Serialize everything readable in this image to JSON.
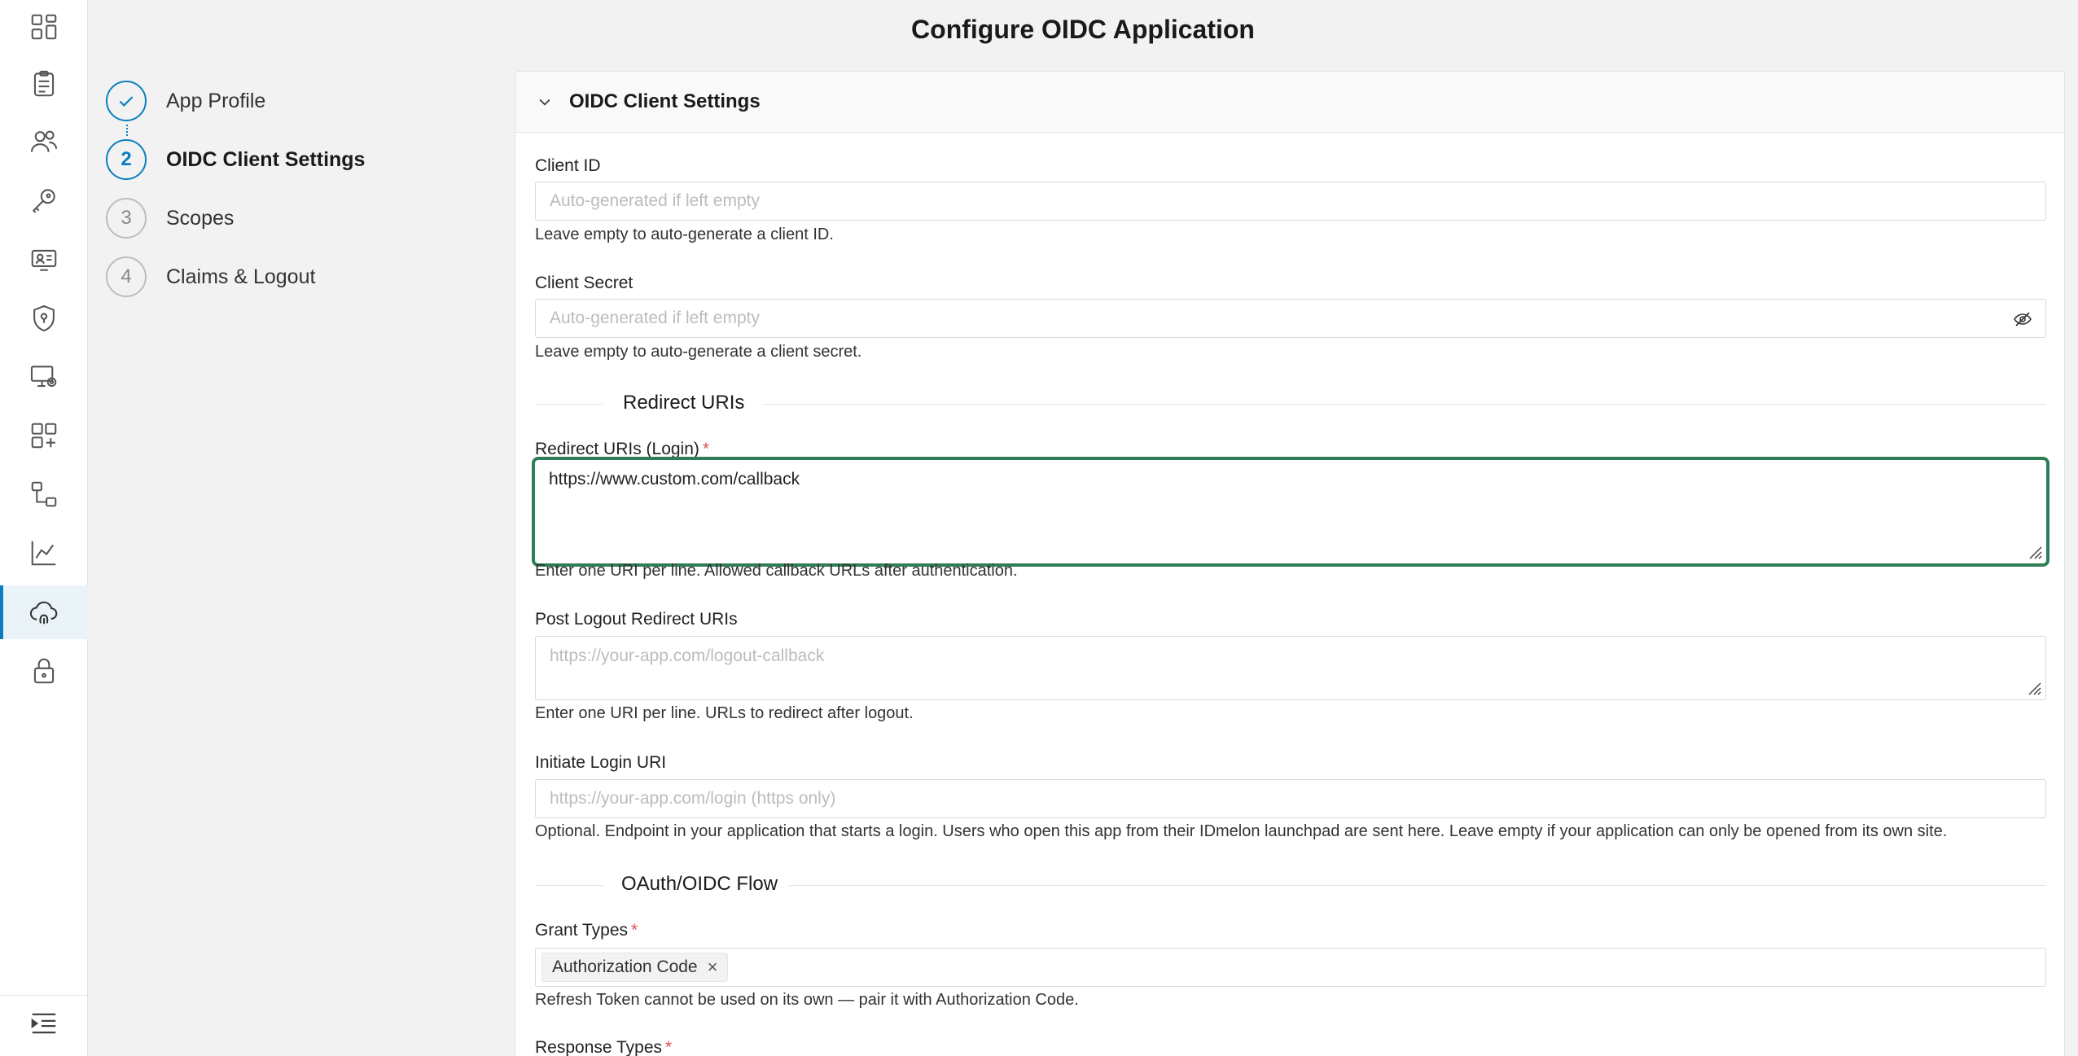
{
  "page": {
    "title": "Configure OIDC Application"
  },
  "rail": {
    "icons": [
      "dashboard-icon",
      "clipboard-icon",
      "users-icon",
      "key-icon",
      "user-card-icon",
      "shield-icon",
      "monitor-settings-icon",
      "apps-add-icon",
      "workflow-icon",
      "chart-icon",
      "cloud-fingerprint-icon",
      "lock-icon"
    ],
    "active_index": 10,
    "bottom_icon": "collapse-menu-icon"
  },
  "stepper": {
    "steps": [
      {
        "number": "",
        "label": "App Profile",
        "state": "done"
      },
      {
        "number": "2",
        "label": "OIDC Client Settings",
        "state": "current"
      },
      {
        "number": "3",
        "label": "Scopes",
        "state": "pending"
      },
      {
        "number": "4",
        "label": "Claims & Logout",
        "state": "pending"
      }
    ]
  },
  "panel": {
    "title": "OIDC Client Settings",
    "client_id": {
      "label": "Client ID",
      "placeholder": "Auto-generated if left empty",
      "help": "Leave empty to auto-generate a client ID."
    },
    "client_secret": {
      "label": "Client Secret",
      "placeholder": "Auto-generated if left empty",
      "help": "Leave empty to auto-generate a client secret."
    },
    "section_redirect": "Redirect URIs",
    "redirect_login": {
      "label": "Redirect URIs (Login)",
      "required_mark": "*",
      "value": "https://www.custom.com/callback",
      "help": "Enter one URI per line. Allowed callback URLs after authentication."
    },
    "post_logout": {
      "label": "Post Logout Redirect URIs",
      "placeholder": "https://your-app.com/logout-callback",
      "help": "Enter one URI per line. URLs to redirect after logout."
    },
    "initiate_login": {
      "label": "Initiate Login URI",
      "placeholder": "https://your-app.com/login (https only)",
      "help": "Optional. Endpoint in your application that starts a login. Users who open this app from their IDmelon launchpad are sent here. Leave empty if your application can only be opened from its own site."
    },
    "section_flow": "OAuth/OIDC Flow",
    "grant_types": {
      "label": "Grant Types",
      "required_mark": "*",
      "tags": [
        "Authorization Code"
      ],
      "help": "Refresh Token cannot be used on its own — pair it with Authorization Code."
    },
    "response_types": {
      "label": "Response Types",
      "required_mark": "*"
    }
  },
  "colors": {
    "accent": "#0a7fbf",
    "focus_border": "#2f7d55",
    "required": "#e05252"
  }
}
